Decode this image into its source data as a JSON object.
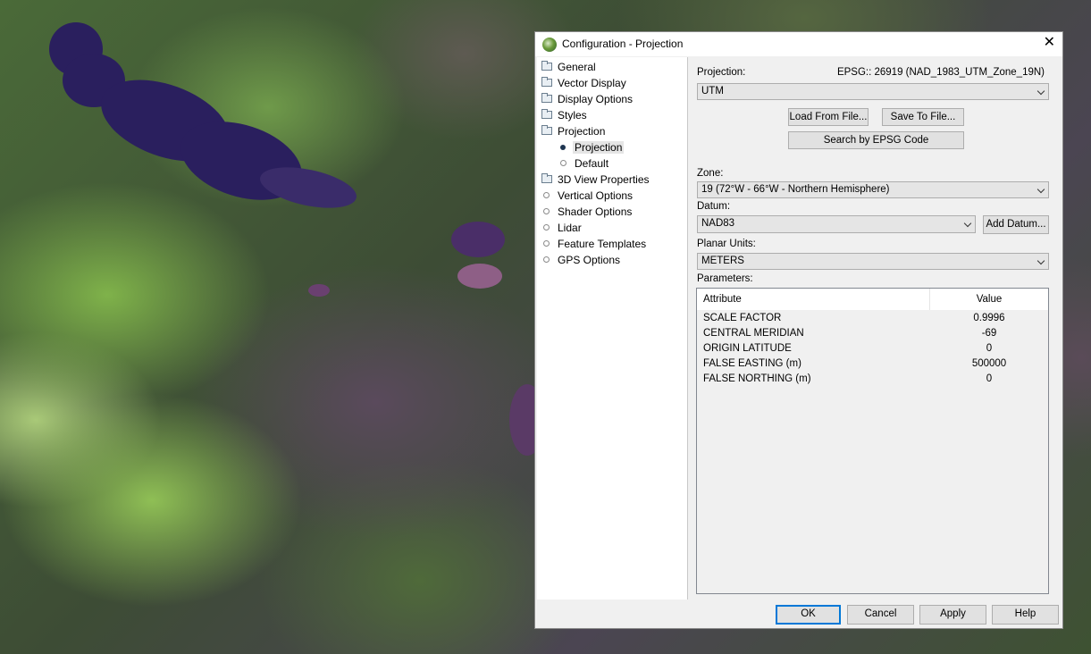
{
  "dialog": {
    "title": "Configuration - Projection",
    "close_glyph": "✕"
  },
  "tree": {
    "items": [
      {
        "label": "General",
        "icon": "folder-icon"
      },
      {
        "label": "Vector Display",
        "icon": "folder-icon"
      },
      {
        "label": "Display Options",
        "icon": "folder-icon"
      },
      {
        "label": "Styles",
        "icon": "folder-icon"
      },
      {
        "label": "Projection",
        "icon": "folder-open-icon"
      },
      {
        "label": "Projection",
        "icon": "bullet-icon",
        "selected": true
      },
      {
        "label": "Default",
        "icon": "circle-icon"
      },
      {
        "label": "3D View Properties",
        "icon": "folder-icon"
      },
      {
        "label": "Vertical Options",
        "icon": "circle-icon"
      },
      {
        "label": "Shader Options",
        "icon": "circle-icon"
      },
      {
        "label": "Lidar",
        "icon": "circle-icon"
      },
      {
        "label": "Feature Templates",
        "icon": "circle-icon"
      },
      {
        "label": "GPS Options",
        "icon": "circle-icon"
      }
    ]
  },
  "projection": {
    "label": "Projection:",
    "epsg_text": "EPSG:: 26919 (NAD_1983_UTM_Zone_19N)",
    "selected": "UTM",
    "load_button": "Load From File...",
    "save_button": "Save To File...",
    "search_button": "Search by EPSG Code"
  },
  "zone": {
    "label": "Zone:",
    "selected": "19 (72°W - 66°W - Northern Hemisphere)"
  },
  "datum": {
    "label": "Datum:",
    "selected": "NAD83",
    "add_button": "Add Datum..."
  },
  "planar_units": {
    "label": "Planar Units:",
    "selected": "METERS"
  },
  "parameters": {
    "label": "Parameters:",
    "col_attribute": "Attribute",
    "col_value": "Value",
    "rows": [
      {
        "attribute": "SCALE FACTOR",
        "value": "0.9996"
      },
      {
        "attribute": "CENTRAL MERIDIAN",
        "value": "-69"
      },
      {
        "attribute": "ORIGIN LATITUDE",
        "value": "0"
      },
      {
        "attribute": "FALSE EASTING (m)",
        "value": "500000"
      },
      {
        "attribute": "FALSE NORTHING (m)",
        "value": "0"
      }
    ]
  },
  "footer": {
    "ok": "OK",
    "cancel": "Cancel",
    "apply": "Apply",
    "help": "Help"
  },
  "colors": {
    "accent": "#0078d7",
    "selected_bullet": "#1e3550",
    "lake": "#2a1f5e"
  }
}
